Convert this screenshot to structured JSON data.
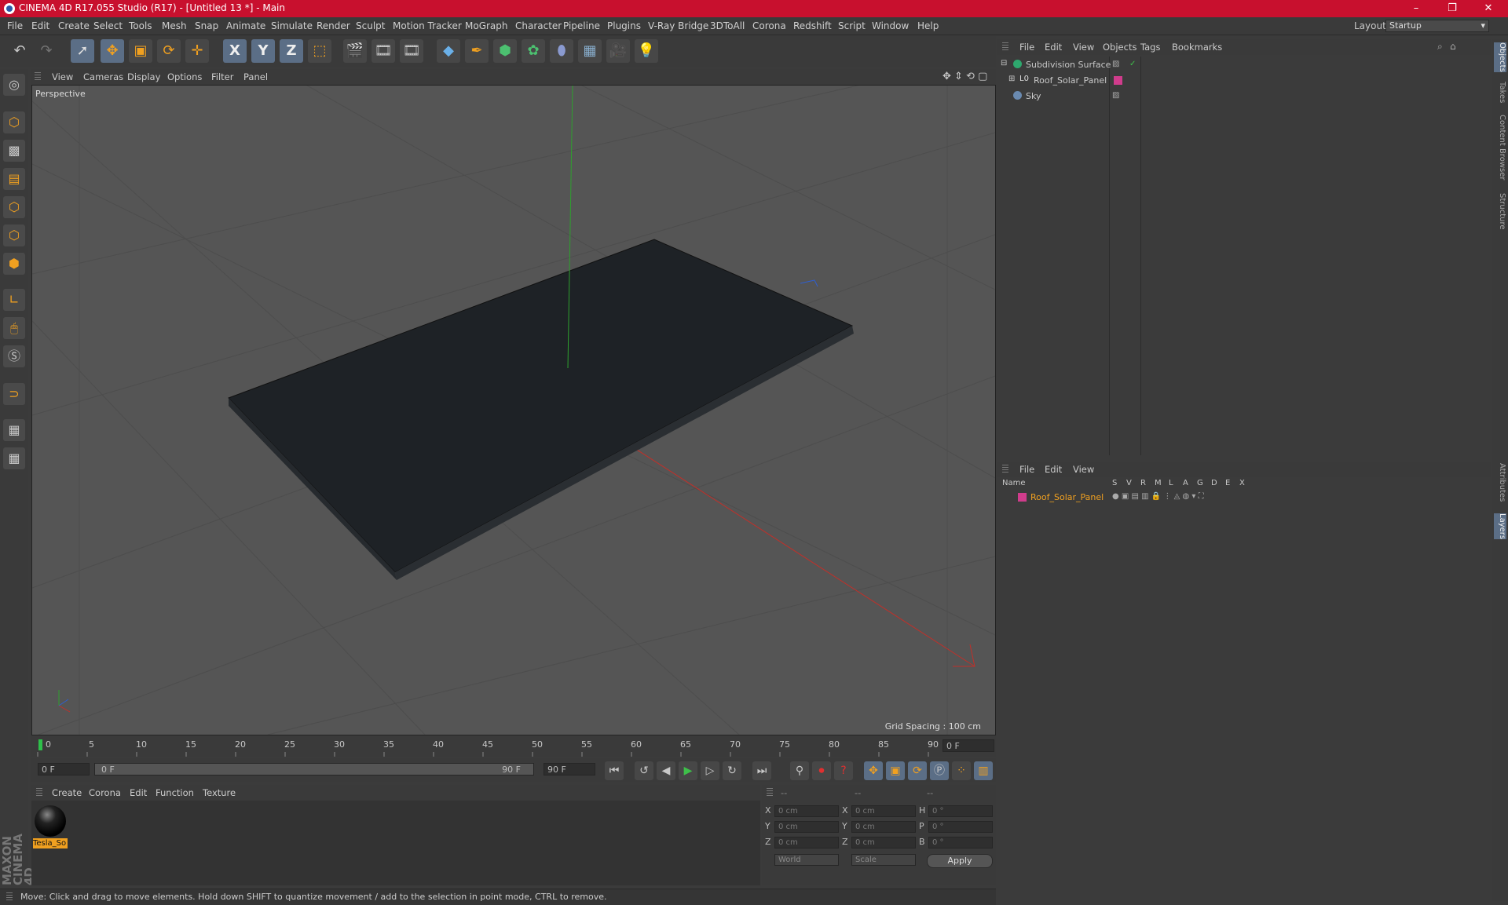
{
  "window": {
    "title": "CINEMA 4D R17.055 Studio (R17) - [Untitled 13 *] - Main",
    "controls": [
      "–",
      "❐",
      "✕"
    ]
  },
  "menubar": {
    "items": [
      "File",
      "Edit",
      "Create",
      "Select",
      "Tools",
      "Mesh",
      "Snap",
      "Animate",
      "Simulate",
      "Render",
      "Sculpt",
      "Motion Tracker",
      "MoGraph",
      "Character",
      "Pipeline",
      "Plugins",
      "V-Ray Bridge",
      "3DToAll",
      "Corona",
      "Redshift",
      "Script",
      "Window",
      "Help"
    ],
    "layout_label": "Layout:",
    "layout_value": "Startup"
  },
  "toolbar": {
    "axis_x": "X",
    "axis_y": "Y",
    "axis_z": "Z"
  },
  "viewport": {
    "menu": [
      "View",
      "Cameras",
      "Display",
      "Options",
      "Filter",
      "Panel"
    ],
    "label": "Perspective",
    "grid_spacing": "Grid Spacing : 100 cm",
    "colors": {
      "bg": "#555555",
      "panel": "#1e2226",
      "x_axis": "#c0302a",
      "y_axis": "#2ea02e",
      "z_axis": "#2f5fd0"
    }
  },
  "timeline": {
    "ticks": [
      "0",
      "5",
      "10",
      "15",
      "20",
      "25",
      "30",
      "35",
      "40",
      "45",
      "50",
      "55",
      "60",
      "65",
      "70",
      "75",
      "80",
      "85",
      "90"
    ],
    "current_frame": "0 F",
    "start_field": "0 F",
    "range_start": "0 F",
    "range_end": "90 F",
    "end_field": "90 F"
  },
  "materials": {
    "menu": [
      "Create",
      "Corona",
      "Edit",
      "Function",
      "Texture"
    ],
    "items": [
      {
        "name": "Tesla_So"
      }
    ]
  },
  "coordinates": {
    "headers": [
      "--",
      "--",
      "--"
    ],
    "rows": [
      {
        "a": "X",
        "av": "0 cm",
        "b": "X",
        "bv": "0 cm",
        "c": "H",
        "cv": "0 °"
      },
      {
        "a": "Y",
        "av": "0 cm",
        "b": "Y",
        "bv": "0 cm",
        "c": "P",
        "cv": "0 °"
      },
      {
        "a": "Z",
        "av": "0 cm",
        "b": "Z",
        "bv": "0 cm",
        "c": "B",
        "cv": "0 °"
      }
    ],
    "mode1": "World",
    "mode2": "Scale",
    "apply": "Apply"
  },
  "objects": {
    "menu": [
      "File",
      "Edit",
      "View",
      "Objects",
      "Tags",
      "Bookmarks"
    ],
    "items": [
      {
        "name": "Subdivision Surface",
        "color": "#2ea86e"
      },
      {
        "name": "Roof_Solar_Panel",
        "color": "#d03c8c"
      },
      {
        "name": "Sky",
        "color": "#6a8ab0"
      }
    ]
  },
  "layers": {
    "menu": [
      "File",
      "Edit",
      "View"
    ],
    "columns": [
      "Name",
      "S",
      "V",
      "R",
      "M",
      "L",
      "A",
      "G",
      "D",
      "E",
      "X"
    ],
    "items": [
      {
        "name": "Roof_Solar_Panel",
        "color": "#d03c8c"
      }
    ]
  },
  "sidetabs": [
    "Objects",
    "Takes",
    "Content Browser",
    "Structure",
    "Attributes",
    "Layers"
  ],
  "status": {
    "text": "Move: Click and drag to move elements. Hold down SHIFT to quantize movement / add to the selection in point mode, CTRL to remove."
  },
  "brand": "MAXON CINEMA 4D"
}
